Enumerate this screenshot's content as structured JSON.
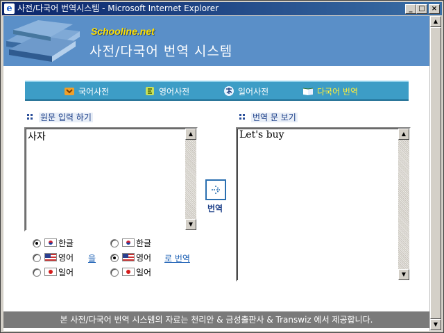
{
  "window": {
    "title": "사전/다국어 번역시스템 - Microsoft Internet Explorer",
    "min": "_",
    "max": "□",
    "close": "×"
  },
  "header": {
    "brand": "Schooline.net",
    "title": "사전/다국어 번역 시스템"
  },
  "menu": [
    {
      "label": "국어사전",
      "icon": "korean-dictionary-icon"
    },
    {
      "label": "영어사전",
      "icon": "english-dictionary-icon"
    },
    {
      "label": "일어사전",
      "icon": "japanese-dictionary-icon"
    },
    {
      "label": "다국어 번역",
      "icon": "open-book-icon",
      "active": true
    }
  ],
  "source": {
    "label": "원문 입력 하기",
    "text": "사자"
  },
  "result": {
    "label": "번역 문 보기",
    "text": "Let's buy"
  },
  "translate_button": {
    "label": "번역",
    "icon": "translate-arrow-icon"
  },
  "source_languages": [
    {
      "label": "한글",
      "flag": "korea-flag-icon",
      "checked": true
    },
    {
      "label": "영어",
      "flag": "usa-flag-icon",
      "checked": false
    },
    {
      "label": "일어",
      "flag": "japan-flag-icon",
      "checked": false
    }
  ],
  "target_languages": [
    {
      "label": "한글",
      "flag": "korea-flag-icon",
      "checked": false
    },
    {
      "label": "영어",
      "flag": "usa-flag-icon",
      "checked": true
    },
    {
      "label": "일어",
      "flag": "japan-flag-icon",
      "checked": false
    }
  ],
  "links": {
    "from": "을",
    "to": "로 번역"
  },
  "footer": "본 사전/다국어 번역 시스템의 자료는 천리안 & 금성출판사 & Transwiz 에서 제공합니다.",
  "colors": {
    "header_bg": "#5a8fc8",
    "menubar_bg": "#3d9dc6",
    "active_menu": "#ffef3a",
    "footer_bg": "#7a7a7a",
    "link": "#1a5fb4"
  }
}
